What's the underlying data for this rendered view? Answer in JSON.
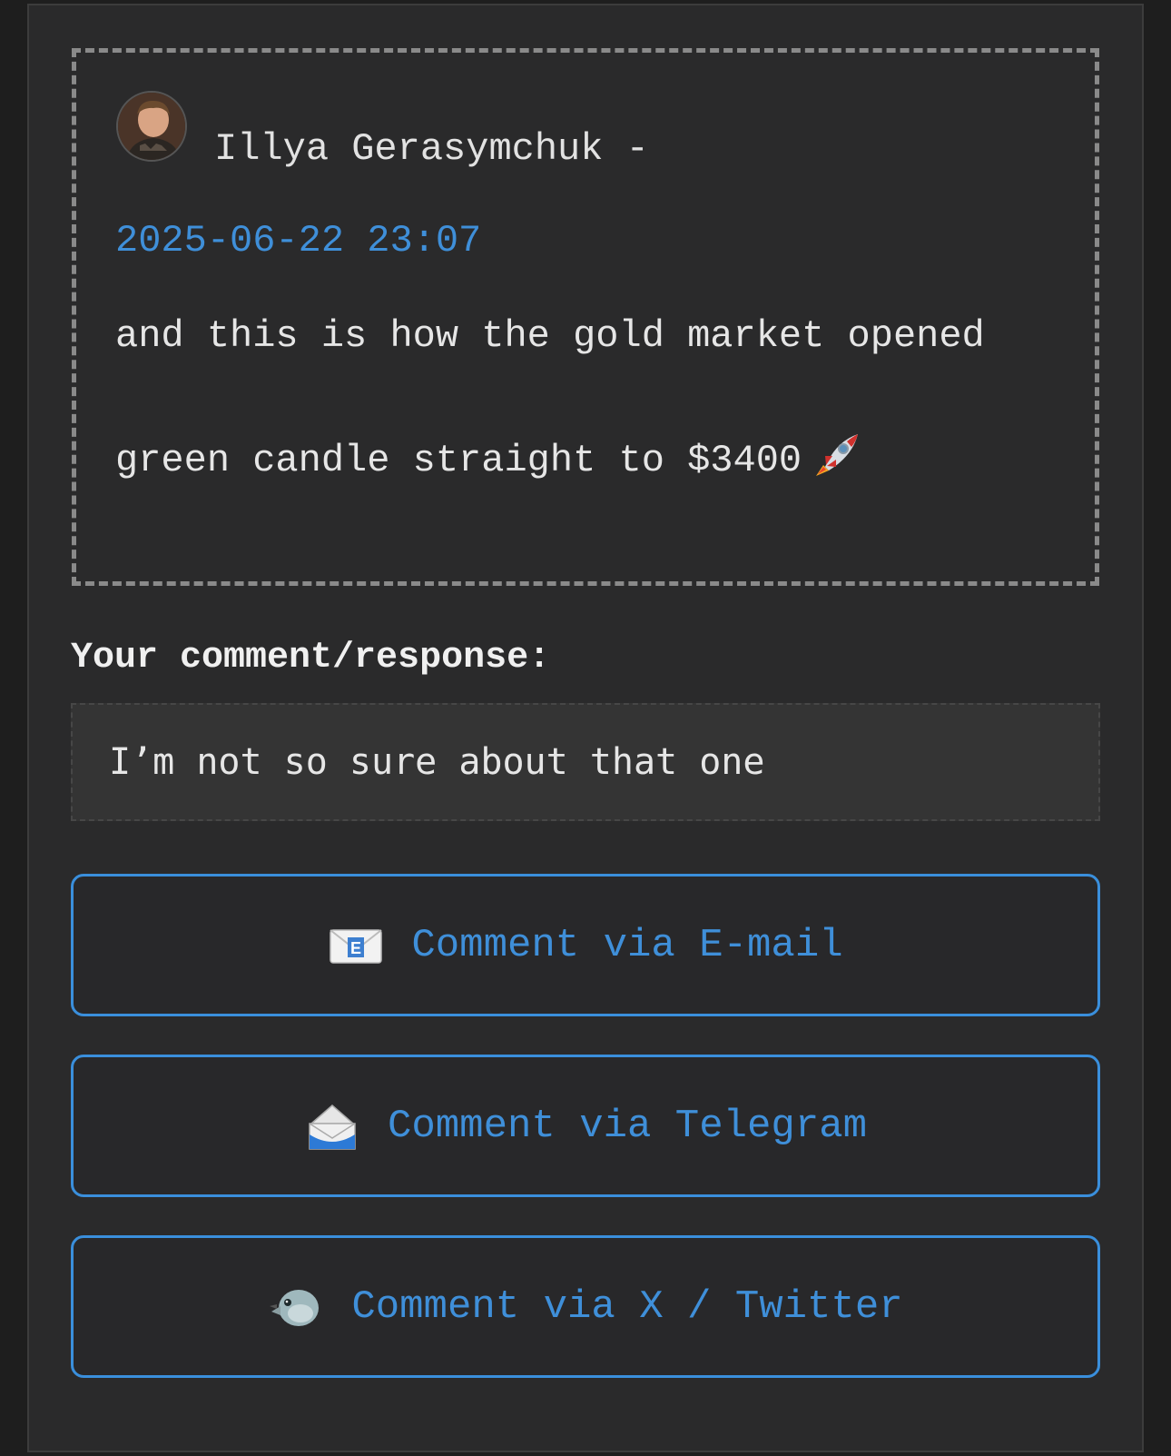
{
  "post": {
    "author": "Illya Gerasymchuk -",
    "timestamp": "2025-06-22 23:07",
    "text_line1": "and this is how the gold market opened",
    "text_line2": "green candle straight to $3400",
    "emoji_icon": "rocket-icon"
  },
  "comment": {
    "label": "Your comment/response:",
    "value": "I’m not so sure about that one"
  },
  "buttons": {
    "email": "Comment via E-mail",
    "telegram": "Comment via Telegram",
    "twitter": "Comment via X / Twitter"
  },
  "colors": {
    "accent": "#3f8fd9",
    "panel_bg": "#2a2a2b",
    "page_bg": "#1e1e1e"
  }
}
